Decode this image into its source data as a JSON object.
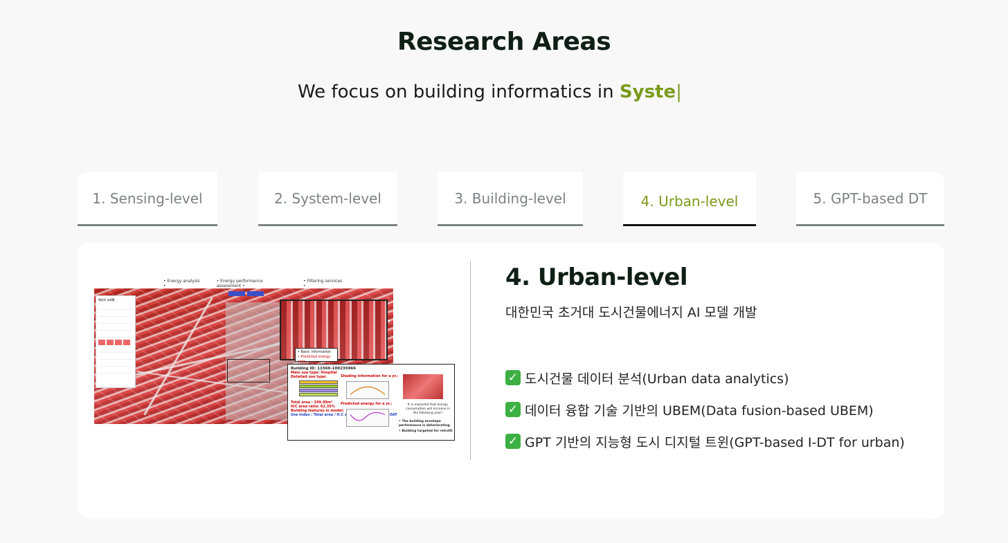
{
  "page": {
    "title": "Research Areas",
    "tagline_prefix": "We focus on building informatics in ",
    "tagline_typed": "Syste",
    "tagline_cursor": "|"
  },
  "tabs": [
    {
      "label": "1. Sensing-level",
      "active": false
    },
    {
      "label": "2. System-level",
      "active": false
    },
    {
      "label": "3. Building-level",
      "active": false
    },
    {
      "label": "4. Urban-level",
      "active": true
    },
    {
      "label": "5. GPT-based DT",
      "active": false
    }
  ],
  "section": {
    "title": "4. Urban-level",
    "subtitle": "대한민국 초거대 도시건물에너지 AI 모델 개발",
    "bullets": [
      "도시건물 데이터 분석(Urban data analytics)",
      "데이터 융합 기술 기반의 UBEM(Data fusion-based UBEM)",
      "GPT 기반의 지능형 도시 디지털 트윈(GPT-based I-DT for urban)"
    ],
    "check_icon": "✓"
  },
  "figure": {
    "menu": [
      "• Energy analysis •",
      "• Energy performance assessment •",
      "• Filtering services •"
    ],
    "panel_title": "에너지 소비량",
    "zoom_label_1": "• Basic information",
    "zoom_label_2": "• Predicted energy cons.",
    "card": {
      "building_id": "Building ID: 11560-100235966",
      "main_use": "Main use type: Hospital",
      "detailed_use": "Detailed use type:",
      "total_area": "Total area : 249.09m²",
      "hc_ratio": "H/C area ratio: 62.35%",
      "features_title": "Building features in model:",
      "features": "Use Index / Total area / H.C area / Shading factor / OAT",
      "shading_title": "Shading information for a yr.:",
      "predicted_title": "Predicted energy for a yr.:",
      "note_1": "It is expected that energy consumption will increase in the following year!",
      "note_2": "• The building envelope performance is deteriorating.",
      "note_3": "• Building targeted for retrofit"
    }
  },
  "colors": {
    "accent": "#7a9a1a",
    "tab_inactive": "#7b8382",
    "check_green": "#3cb043",
    "map_red": "#c0392b"
  }
}
